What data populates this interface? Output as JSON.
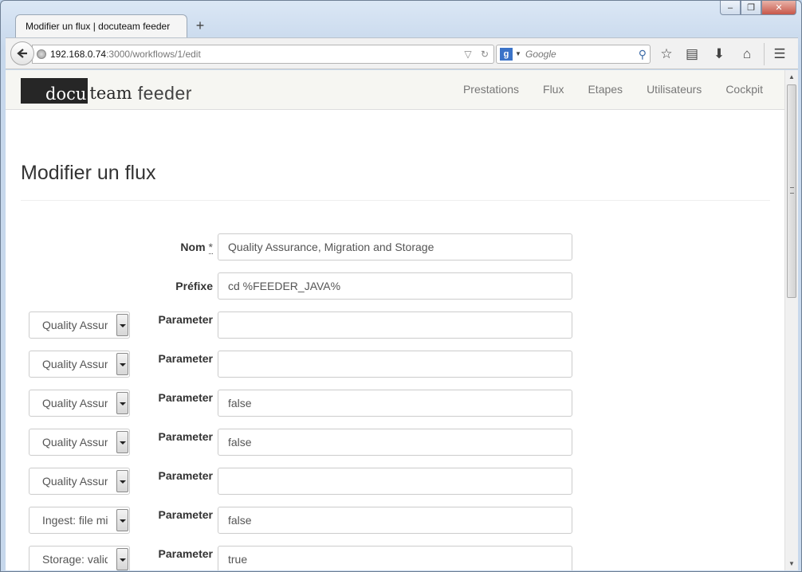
{
  "browser": {
    "tab_title": "Modifier un flux | docuteam feeder",
    "url_host": "192.168.0.74",
    "url_path": ":3000/workflows/1/edit",
    "search_placeholder": "Google",
    "icons": [
      "back-icon",
      "globe-icon",
      "reload-icon",
      "google-icon",
      "search-icon",
      "star-icon",
      "reading-list-icon",
      "download-icon",
      "home-icon",
      "menu-icon"
    ]
  },
  "site": {
    "logo_docu": "docu",
    "logo_team": "team",
    "logo_feeder": "feeder",
    "menu": [
      "Prestations",
      "Flux",
      "Etapes",
      "Utilisateurs",
      "Cockpit"
    ]
  },
  "page": {
    "title": "Modifier un flux"
  },
  "form": {
    "name_label": "Nom",
    "name_required": "*",
    "name_value": "Quality Assurance, Migration and Storage",
    "prefix_label": "Préfixe",
    "prefix_value": "cd %FEEDER_JAVA%",
    "steps": [
      {
        "step": "Quality Assurance",
        "label": "Parameter",
        "value": ""
      },
      {
        "step": "Quality Assurance",
        "label": "Parameter",
        "value": ""
      },
      {
        "step": "Quality Assurance",
        "label": "Parameter",
        "value": "false"
      },
      {
        "step": "Quality Assurance",
        "label": "Parameter",
        "value": "false"
      },
      {
        "step": "Quality Assurance",
        "label": "Parameter",
        "value": ""
      },
      {
        "step": "Ingest: file migration",
        "label": "Parameter",
        "value": "false"
      },
      {
        "step": "Storage: validate",
        "label": "Parameter",
        "value": "true"
      }
    ]
  }
}
